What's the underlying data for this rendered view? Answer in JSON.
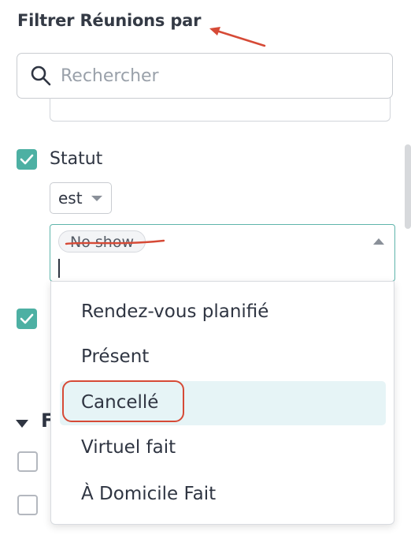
{
  "filter": {
    "title": "Filtrer Réunions par",
    "search_placeholder": "Rechercher"
  },
  "statut": {
    "label": "Statut",
    "operator": "est",
    "selected_chip": "No show",
    "options": [
      "Rendez-vous planifié",
      "Présent",
      "Cancellé",
      "Virtuel fait",
      "À Domicile Fait"
    ],
    "highlighted_option": "Cancellé"
  },
  "section": {
    "partial_heading": "F"
  },
  "annotations": {
    "arrow_color": "#d64a36",
    "circle_color": "#d64a36",
    "strike_color": "#d64a36"
  },
  "colors": {
    "accent": "#4db0a3",
    "highlight_bg": "#e6f4f6"
  }
}
